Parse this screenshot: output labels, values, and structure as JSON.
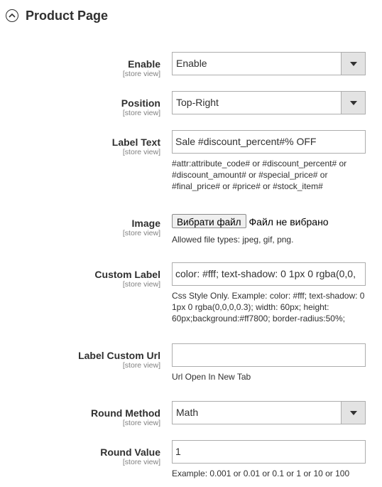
{
  "section": {
    "title": "Product Page"
  },
  "fields": {
    "enable": {
      "label": "Enable",
      "scope": "[store view]",
      "value": "Enable"
    },
    "position": {
      "label": "Position",
      "scope": "[store view]",
      "value": "Top-Right"
    },
    "label_text": {
      "label": "Label Text",
      "scope": "[store view]",
      "value": "Sale #discount_percent#% OFF",
      "note": "#attr:attribute_code# or #discount_percent# or #discount_amount# or #special_price# or #final_price# or #price# or #stock_item#"
    },
    "image": {
      "label": "Image",
      "scope": "[store view]",
      "button": "Вибрати файл",
      "status": "Файл не вибрано",
      "note": "Allowed file types: jpeg, gif, png."
    },
    "custom_label": {
      "label": "Custom Label",
      "scope": "[store view]",
      "value": "color: #fff; text-shadow: 0 1px 0 rgba(0,0,",
      "note": "Css Style Only. Example: color: #fff; text-shadow: 0 1px 0 rgba(0,0,0,0.3); width: 60px; height: 60px;background:#ff7800; border-radius:50%;"
    },
    "custom_url": {
      "label": "Label Custom Url",
      "scope": "[store view]",
      "value": "",
      "note": "Url Open In New Tab"
    },
    "round_method": {
      "label": "Round Method",
      "scope": "[store view]",
      "value": "Math"
    },
    "round_value": {
      "label": "Round Value",
      "scope": "[store view]",
      "value": "1",
      "note": "Example: 0.001 or 0.01 or 0.1 or 1 or 10 or 100"
    }
  }
}
